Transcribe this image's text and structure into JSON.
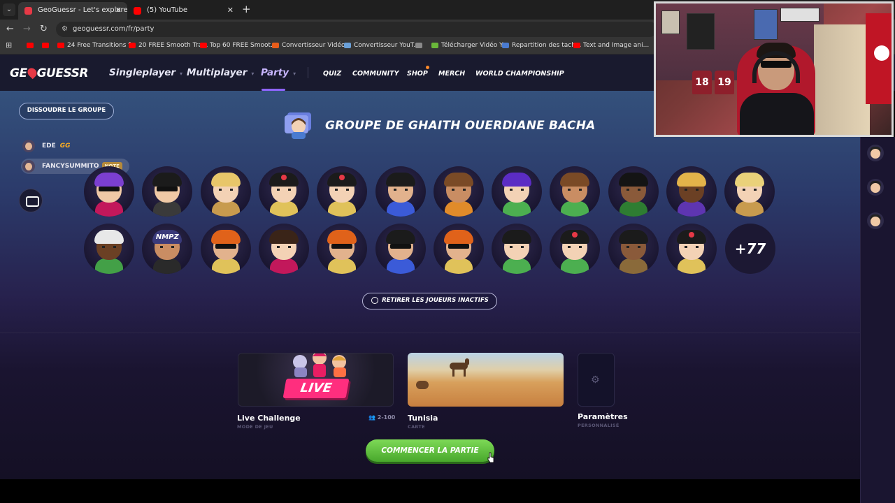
{
  "browser": {
    "tabs": [
      {
        "title": "GeoGuessr - Let's explore the w",
        "active": true,
        "favicon_color": "#e63946"
      },
      {
        "title": "(5) YouTube",
        "active": false,
        "favicon_color": "#ff0000"
      }
    ],
    "url": "geoguessr.com/fr/party",
    "bookmarks": [
      {
        "label": "",
        "color": "#ff0000"
      },
      {
        "label": "",
        "color": "#ff0000"
      },
      {
        "label": "24 Free Transitions f...",
        "color": "#ff0000"
      },
      {
        "label": "20 FREE Smooth Tra...",
        "color": "#ff0000"
      },
      {
        "label": "Top 60 FREE Smoot...",
        "color": "#ff0000"
      },
      {
        "label": "Convertisseur Vidéo...",
        "color": "#e85d1a"
      },
      {
        "label": "Convertisseur YouT...",
        "color": "#6aa0d8"
      },
      {
        "label": "",
        "color": "#8a8a8a"
      },
      {
        "label": "Télécharger Vidéo Y...",
        "color": "#6ab83a"
      },
      {
        "label": "Repartition des tach...",
        "color": "#4a7bd0"
      },
      {
        "label": "Text and Image ani...",
        "color": "#ff0000"
      }
    ]
  },
  "header": {
    "logo": "GEOGUESSR",
    "nav": [
      {
        "label": "Singleplayer",
        "active": false
      },
      {
        "label": "Multiplayer",
        "active": false
      },
      {
        "label": "Party",
        "active": true
      }
    ],
    "subnav": [
      "QUIZ",
      "COMMUNITY",
      "SHOP",
      "MERCH",
      "WORLD CHAMPIONSHIP"
    ]
  },
  "party": {
    "dissolve_label": "DISSOUDRE LE GROUPE",
    "title": "GROUPE DE GHAITH OUERDIANE BACHA",
    "more_count": "+77",
    "kick_label": "RETIRER LES JOUEURS INACTIFS"
  },
  "chat": [
    {
      "name": "EDE",
      "emote": "GG",
      "tag": ""
    },
    {
      "name": "FANCYSUMMITO",
      "emote": "",
      "tag": "NOTE"
    }
  ],
  "players_row1": [
    {
      "skin": "#f0c9a6",
      "hair": "#7b3fd0",
      "shirt": "#c2185b",
      "acc": "glasses"
    },
    {
      "skin": "#f0c9a6",
      "hair": "#1b1b1b",
      "shirt": "#3a3a3a",
      "acc": "glasses"
    },
    {
      "skin": "#f3d2b5",
      "hair": "#e8c66a",
      "shirt": "#c89b4e",
      "acc": ""
    },
    {
      "skin": "#f3d2b5",
      "hair": "#1b1b1b",
      "shirt": "#e0c25a",
      "acc": "cap"
    },
    {
      "skin": "#f3d2b5",
      "hair": "#1b1b1b",
      "shirt": "#e0c25a",
      "acc": "cap"
    },
    {
      "skin": "#e2b28d",
      "hair": "#1b1b1b",
      "shirt": "#3b5bd8",
      "acc": ""
    },
    {
      "skin": "#c98d63",
      "hair": "#7a4a26",
      "shirt": "#e08b2a",
      "acc": ""
    },
    {
      "skin": "#f3d2b5",
      "hair": "#5b2cc4",
      "shirt": "#4caf50",
      "acc": ""
    },
    {
      "skin": "#c98d63",
      "hair": "#7a4a26",
      "shirt": "#4caf50",
      "acc": ""
    },
    {
      "skin": "#8a5a3a",
      "hair": "#141414",
      "shirt": "#2e7d32",
      "acc": ""
    },
    {
      "skin": "#6b4024",
      "hair": "#e3b34a",
      "shirt": "#5e35b1",
      "acc": ""
    },
    {
      "skin": "#f3d2b5",
      "hair": "#ead17a",
      "shirt": "#c89b4e",
      "acc": ""
    }
  ],
  "players_row2": [
    {
      "skin": "#6b4024",
      "hair": "#e8e8e8",
      "shirt": "#43a047",
      "acc": ""
    },
    {
      "skin": "#c98d63",
      "hair": "#3a3a7a",
      "shirt": "#2a2a2a",
      "acc": "nmpz"
    },
    {
      "skin": "#e2b28d",
      "hair": "#e0621a",
      "shirt": "#e0c25a",
      "acc": "glasses"
    },
    {
      "skin": "#f3d2b5",
      "hair": "#3a2418",
      "shirt": "#c2185b",
      "acc": ""
    },
    {
      "skin": "#e2b28d",
      "hair": "#e0621a",
      "shirt": "#e0c25a",
      "acc": "glasses"
    },
    {
      "skin": "#e2b28d",
      "hair": "#1b1b1b",
      "shirt": "#3b5bd8",
      "acc": "glasses"
    },
    {
      "skin": "#e2b28d",
      "hair": "#e0621a",
      "shirt": "#e0c25a",
      "acc": "glasses"
    },
    {
      "skin": "#f3d2b5",
      "hair": "#1b1b1b",
      "shirt": "#4caf50",
      "acc": ""
    },
    {
      "skin": "#f3d2b5",
      "hair": "#1b1b1b",
      "shirt": "#4caf50",
      "acc": "cap"
    },
    {
      "skin": "#8a5a3a",
      "hair": "#1b1b1b",
      "shirt": "#8a6a3a",
      "acc": ""
    },
    {
      "skin": "#f3d2b5",
      "hair": "#1b1b1b",
      "shirt": "#e0c25a",
      "acc": "cap"
    }
  ],
  "nmpz_text": "NMPZ",
  "settings": {
    "mode": {
      "title": "Live Challenge",
      "sub": "MODE DE JEU",
      "badge": "LIVE",
      "limit": "2-100"
    },
    "map": {
      "title": "Tunisia",
      "sub": "CARTE"
    },
    "params": {
      "title": "Paramètres",
      "sub": "PERSONNALISÉ"
    }
  },
  "start_label": "COMMENCER LA PARTIE",
  "webcam": {
    "jersey1": "18",
    "jersey2": "19"
  },
  "colors": {
    "accent": "#8f65ff",
    "start_green": "#5bc23a",
    "live_pink": "#ff2e7e"
  }
}
